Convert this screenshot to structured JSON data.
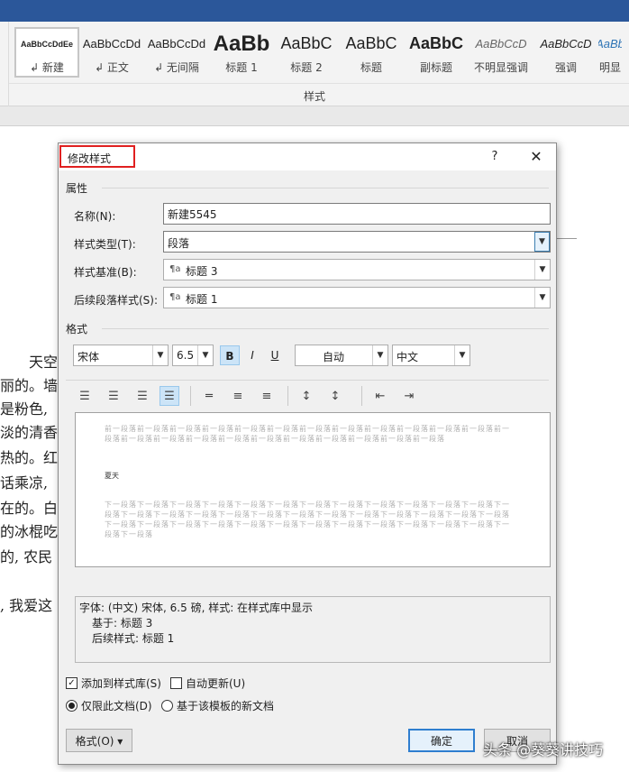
{
  "ribbon": {
    "styles": [
      {
        "preview": "AaBbCcDdEe",
        "name": "↲ 新建",
        "selected": true
      },
      {
        "preview": "AaBbCcDd",
        "name": "↲ 正文",
        "selected": false
      },
      {
        "preview": "AaBbCcDd",
        "name": "↲ 无间隔",
        "selected": false
      },
      {
        "preview": "AaBb",
        "name": "标题 1",
        "selected": false
      },
      {
        "preview": "AaBbC",
        "name": "标题 2",
        "selected": false
      },
      {
        "preview": "AaBbC",
        "name": "标题",
        "selected": false
      },
      {
        "preview": "AaBbC",
        "name": "副标题",
        "selected": false
      },
      {
        "preview": "AaBbCcD",
        "name": "不明显强调",
        "selected": false
      },
      {
        "preview": "AaBbCcD",
        "name": "强调",
        "selected": false
      },
      {
        "preview": "AaBb",
        "name": "明显",
        "selected": false
      }
    ],
    "group_label": "样式"
  },
  "document": {
    "lines": [
      "天空",
      "丽的。墙",
      "是粉色,",
      "淡的清香",
      "热的。红",
      "话乘凉,",
      "在的。白",
      "的冰棍吃",
      "的, 农民",
      ", 我爱这"
    ]
  },
  "dialog": {
    "title": "修改样式",
    "help": "?",
    "close": "✕",
    "properties_label": "属性",
    "name_label": "名称(N):",
    "name_value": "新建5545",
    "style_type_label": "样式类型(T):",
    "style_type_value": "段落",
    "style_based_label": "样式基准(B):",
    "style_based_value": "标题 3",
    "next_style_label": "后续段落样式(S):",
    "next_style_value": "标题 1",
    "format_label": "格式",
    "font_value": "宋体",
    "size_value": "6.5",
    "bold": "B",
    "italic": "I",
    "underline": "U",
    "color_value": "自动",
    "lang_value": "中文",
    "preview": {
      "prev_text": "前一段落前一段落前一段落前一段落前一段落前一段落前一段落前一段落前一段落前一段落前一段落前一段落前一段落前一段落前一段落前一段落前一段落前一段落前一段落前一段落前一段落前一段落前一段落",
      "current_text": "夏天",
      "next_text": "下一段落下一段落下一段落下一段落下一段落下一段落下一段落下一段落下一段落下一段落下一段落下一段落下一段落下一段落下一段落下一段落下一段落下一段落下一段落下一段落下一段落下一段落下一段落下一段落下一段落下一段落下一段落下一段落下一段落下一段落下一段落下一段落下一段落下一段落下一段落下一段落下一段落下一段落下一段落"
    },
    "description": {
      "line1": "字体: (中文) 宋体, 6.5 磅, 样式: 在样式库中显示",
      "line2": "基于: 标题 3",
      "line3": "后续样式: 标题 1"
    },
    "add_to_gallery": "添加到样式库(S)",
    "auto_update": "自动更新(U)",
    "only_this_doc": "仅限此文档(D)",
    "new_docs_template": "基于该模板的新文档",
    "format_button": "格式(O) ▾",
    "ok": "确定",
    "cancel": "取消"
  },
  "watermark": "头条 @葵葵讲技巧"
}
